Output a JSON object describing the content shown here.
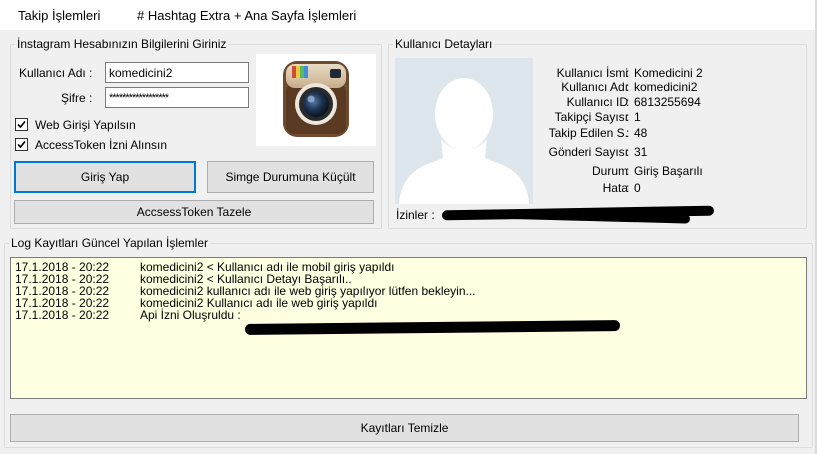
{
  "tabs": [
    {
      "label": "Takip İşlemleri"
    },
    {
      "label": "# Hashtag Extra + Ana Sayfa İşlemleri"
    }
  ],
  "login": {
    "legend": "İnstagram Hesabınızın Bilgilerini Giriniz",
    "username_label": "Kullanıcı Adı :",
    "username_value": "komedicini2",
    "password_label": "Şifre :",
    "password_value": "******************",
    "web_login_label": "Web Girişi Yapılsın",
    "web_login_checked": true,
    "accesstoken_label": "AccessToken İzni Alınsın",
    "accesstoken_checked": true,
    "login_button": "Giriş Yap",
    "minimize_button": "Simge Durumuna Küçült",
    "refresh_token_button": "AccsessToken Tazele",
    "logo_icon": "instagram-camera-icon"
  },
  "details": {
    "legend": "Kullanıcı Detayları",
    "avatar_icon": "default-user-silhouette-icon",
    "rows": [
      {
        "label": "Kullanıcı İsmi",
        "value": "Komedicini 2"
      },
      {
        "label": "Kullanıcı Adı",
        "value": "komedicini2"
      },
      {
        "label": "Kullanıcı ID",
        "value": "6813255694"
      },
      {
        "label": "Takipçi Sayısı",
        "value": "1"
      },
      {
        "label": "Takip Edilen S.",
        "value": "48"
      },
      {
        "label": "Gönderi Sayısı",
        "value": "31"
      },
      {
        "label": "Durum",
        "value": "Giriş Başarılı"
      },
      {
        "label": "Hata",
        "value": "0"
      }
    ],
    "separator": ":",
    "permissions_label": "İzinler :"
  },
  "log": {
    "legend": "Log Kayıtları Güncel Yapılan İşlemler",
    "lines": [
      {
        "time": "17.1.2018 - 20:22",
        "text": "komedicini2 < Kullanıcı adı ile mobil giriş yapıldı"
      },
      {
        "time": "17.1.2018 - 20:22",
        "text": "komedicini2 < Kullanıcı Detayı Başarılı.."
      },
      {
        "time": "17.1.2018 - 20:22",
        "text": "komedicini2 kullanıcı adı ile web giriş yapılıyor lütfen bekleyin..."
      },
      {
        "time": "17.1.2018 - 20:22",
        "text": "komedicini2 Kullanıcı adı ile web giriş yapıldı"
      },
      {
        "time": "17.1.2018 - 20:22",
        "text": "Api İzni Oluşruldu :"
      }
    ],
    "clear_button": "Kayıtları Temizle",
    "background_color": "#ffffe1"
  },
  "colors": {
    "focus_border": "#0078d7",
    "redaction": "#000000"
  }
}
